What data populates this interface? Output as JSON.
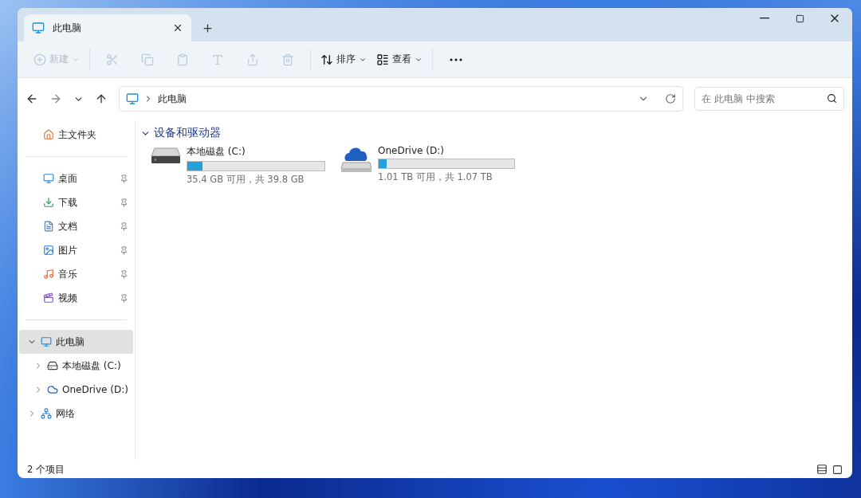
{
  "tab": {
    "title": "此电脑",
    "selected": true
  },
  "toolbar": [
    {
      "kind": "new",
      "label": "新建",
      "disabled": true
    },
    {
      "kind": "cut",
      "disabled": true
    },
    {
      "kind": "copy",
      "disabled": true
    },
    {
      "kind": "paste",
      "disabled": true
    },
    {
      "kind": "rename",
      "disabled": true
    },
    {
      "kind": "share",
      "disabled": true
    },
    {
      "kind": "delete",
      "disabled": true
    },
    {
      "kind": "sort",
      "label": "排序",
      "disabled": false
    },
    {
      "kind": "view",
      "label": "查看",
      "disabled": false
    },
    {
      "kind": "more",
      "disabled": false
    }
  ],
  "address": {
    "path": "此电脑"
  },
  "search": {
    "placeholder": "在 此电脑 中搜索"
  },
  "sidebar": {
    "home": {
      "label": "主文件夹",
      "kind": "home"
    },
    "quick_access": [
      {
        "label": "桌面",
        "kind": "desktop",
        "pinned": true
      },
      {
        "label": "下载",
        "kind": "download",
        "pinned": true
      },
      {
        "label": "文档",
        "kind": "document",
        "pinned": true
      },
      {
        "label": "图片",
        "kind": "pictures",
        "pinned": true
      },
      {
        "label": "音乐",
        "kind": "music",
        "pinned": true
      },
      {
        "label": "视频",
        "kind": "video",
        "pinned": true
      }
    ],
    "tree": [
      {
        "label": "此电脑",
        "kind": "pc",
        "expanded": true,
        "selected": true,
        "children": [
          {
            "label": "本地磁盘 (C:)",
            "kind": "hdd",
            "expanded": false,
            "selected": false
          },
          {
            "label": "OneDrive (D:)",
            "kind": "cloud",
            "expanded": false,
            "selected": false
          }
        ]
      },
      {
        "label": "网络",
        "kind": "network",
        "expanded": false,
        "selected": false
      }
    ]
  },
  "group": {
    "title": "设备和驱动器",
    "expanded": true
  },
  "drives": [
    {
      "name": "本地磁盘 (C:)",
      "kind": "hdd",
      "level": 0.11,
      "space": "35.4 GB 可用，共 39.8 GB"
    },
    {
      "name": "OneDrive (D:)",
      "kind": "cloud",
      "level": 0.06,
      "space": "1.01 TB 可用，共 1.07 TB"
    }
  ],
  "status_bar": {
    "count": "2 个项目"
  }
}
